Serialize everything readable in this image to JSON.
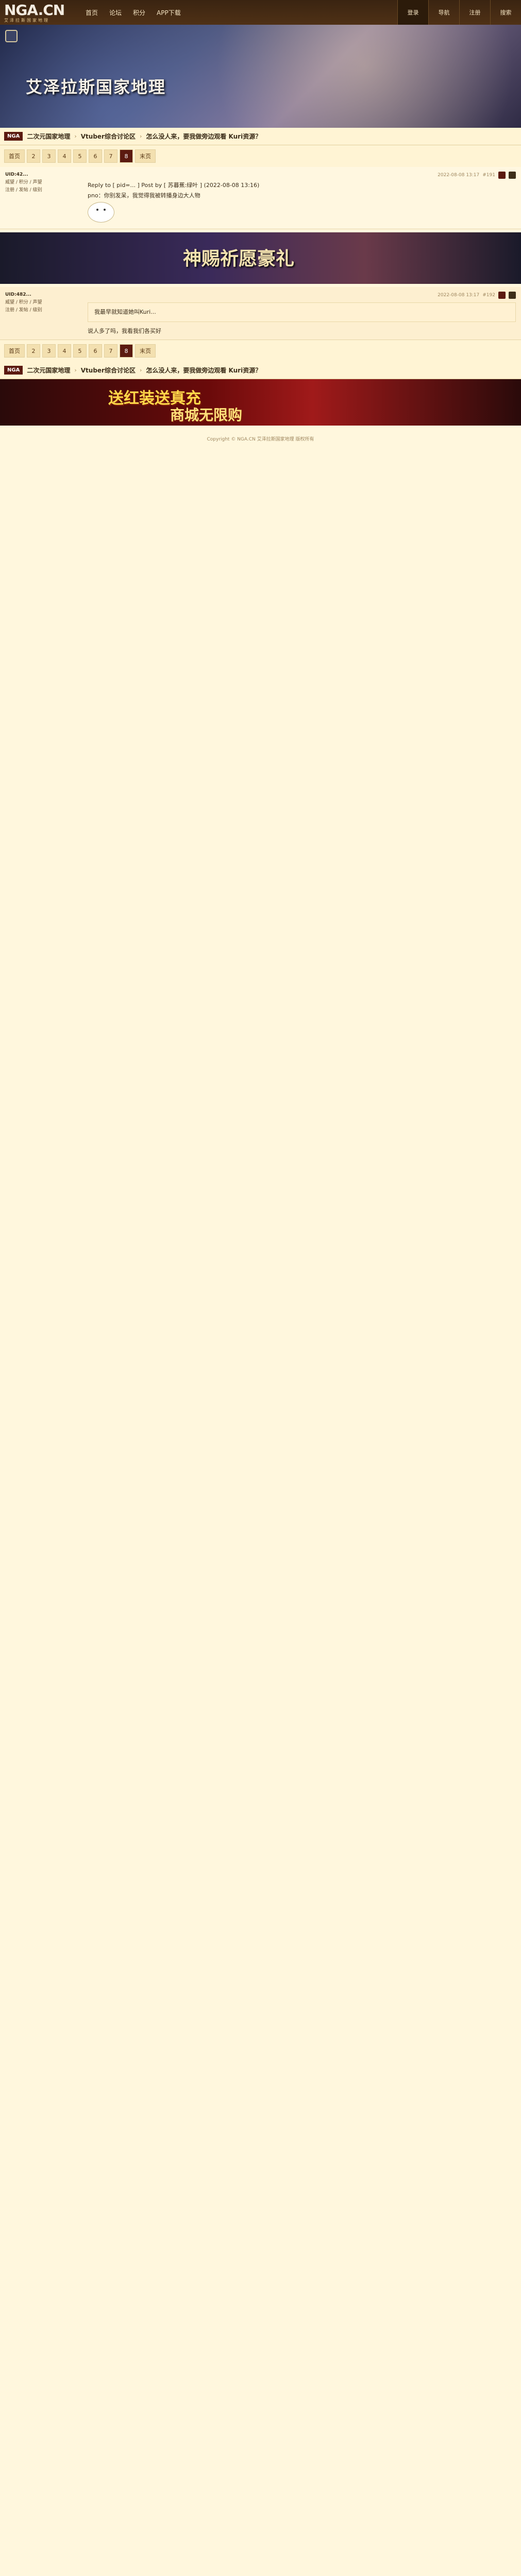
{
  "topbar": {
    "logo_big": "NGA.CN",
    "logo_small": "艾泽拉斯国家地理",
    "nav": [
      "首页",
      "论坛",
      "积分",
      "APP下载"
    ],
    "right": [
      "登录",
      "导航",
      "注册",
      "搜索"
    ]
  },
  "banner": {
    "title": "艾泽拉斯国家地理"
  },
  "breadcrumb": {
    "home": "NGA",
    "items": [
      "二次元国家地理",
      "Vtuber综合讨论区",
      "怎么没人来，要我做旁边观看 Kuri资源？"
    ]
  },
  "pager": {
    "first": "首页",
    "pages": [
      "2",
      "3",
      "4",
      "5",
      "6",
      "7",
      "8"
    ],
    "last": "末页",
    "current": "8"
  },
  "posts": [
    {
      "user": "UID:42...",
      "meta": [
        "威望 / 积分 / 声望",
        "注册 / 发帖 / 级别"
      ],
      "time": "2022-08-08 13:17",
      "floor": "#191",
      "reply_to": "Reply to [ pid=... ] Post by [ 苏暮蕉:绿叶 ] (2022-08-08 13:16)",
      "text": "pno：你别发呆，我觉得我被转播身边大人物"
    },
    {
      "user": "UID:482...",
      "meta": [
        "威望 / 积分 / 声望",
        "注册 / 发帖 / 级别"
      ],
      "time": "2022-08-08 13:17",
      "floor": "#192",
      "quote": "我最早就知道她叫Kuri...",
      "text": "说人多了吗，我看我们各买好"
    }
  ],
  "ad": {
    "title": "神赐祈愿豪礼"
  },
  "ad2": {
    "line1": "送红装送真充",
    "line2": "商城无限购"
  },
  "footer": {
    "text": "Copyright © NGA.CN 艾泽拉斯国家地理 版权所有"
  }
}
